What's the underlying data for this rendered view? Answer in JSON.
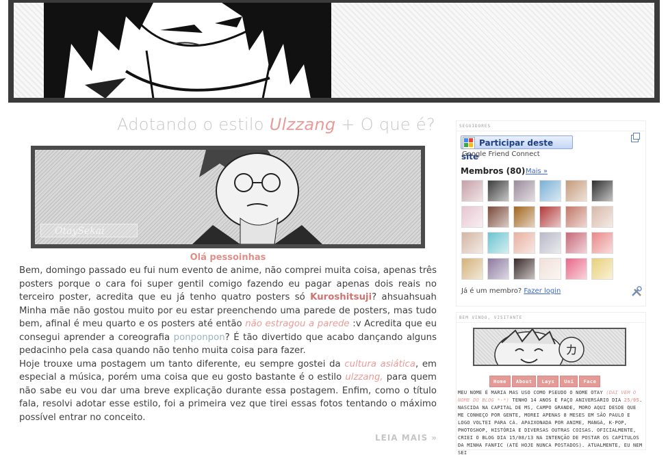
{
  "post": {
    "title_before": "Adotando o estilo ",
    "title_highlight": "Ulzzang",
    "title_after": " + O que é?",
    "watermark": "OtaySekai",
    "greeting": "Olá pessoinhas",
    "p1_a": "Bem, domingo passado eu fui num evento de anime, não comprei muita coisa, apenas três posters porque o cara foi super gentil comigo fazendo eu pagar apenas dois reais no terceiro poster, acredita que eu já tenho quatro posters só ",
    "p1_kuro": "Kuroshitsuji",
    "p1_b": "? ahsuahsuah Minha mãe não gostou muito por eu estar preenchendo uma parede de posters, mas tudo bem, afinal é meu quarto e os posters até então ",
    "p1_link": "não estragou a parede",
    "p1_c": " :v Acredita que eu consegui aprender a coreografia ",
    "p1_ponpon": "ponponpon",
    "p1_d": "? É tão divertido que acabo dançando alguns pedacinho pela casa quando não tenho muita coisa para fazer.",
    "p2_a": "Hoje trouxe uma postagem um tanto diferente, eu sempre gostei da ",
    "p2_cultura": "cultura asiática",
    "p2_b": ", em especial a música, porém uma coisa que eu gosto bastante é o estilo ",
    "p2_ulzzang": "ulzzang,",
    "p2_c": " para quem não sabe eu vou dar uma breve explicação durante essa postagem. Enfim, como o título fala, resolvi adotar esse estilo, foi a primeira vez que tirei essas fotos tentando o máximo possível entrar no conceito.",
    "read_more": "LEIA MAIS »"
  },
  "followers": {
    "title": "Seguidores",
    "join_button": "Participar deste site",
    "subtitle": "Google Friend Connect",
    "members_label": "Membros (80)",
    "more_link": "Mais »",
    "already_member": "Já é um membro?",
    "login_link": "Fazer login",
    "avatar_colors": [
      "#c6a0a8",
      "#3c3c3c",
      "#9a8b9a",
      "#7ab0d6",
      "#c49a7a",
      "#2e2e2e",
      "#e6c6d0",
      "#7a4a3a",
      "#a2661e",
      "#b23a3a",
      "#c27868",
      "#d8b8a8",
      "#d2b6a2",
      "#6ac4d0",
      "#e8b0a0",
      "#b8b8c8",
      "#c86878",
      "#e88888",
      "#d4b27a",
      "#8c7aa0",
      "#3a2a2a",
      "#f0e0d8",
      "#e86888",
      "#e8d078"
    ]
  },
  "about": {
    "title": "Bem vindo, visitante",
    "nav": [
      "Home",
      "About",
      "Lays",
      "Uni",
      "Face"
    ],
    "text_a": "Meu nome é Maria mas uso como pseudo o nome Otay ",
    "text_pk1": "(dai vem o nome do blog *-*)",
    "text_b": " tenho 14 anos e faço aniversário dia ",
    "text_date": "25/05",
    "text_c": ". Nascida na capital de MS, Campo Grande, moro aqui desde que me conheço por gente, morei apenas 8 meses em São Paulo e logo voltei para cá. Apaixonada por anime, mangá, k-pop, photoshop, história e diversas outras coisas. Oficialmente, criei o blog dia 15/08/13 na intenção de postar os capítulos da minha fanfic (até hoje nunca postados). Atualmente, eu nem sei"
  }
}
